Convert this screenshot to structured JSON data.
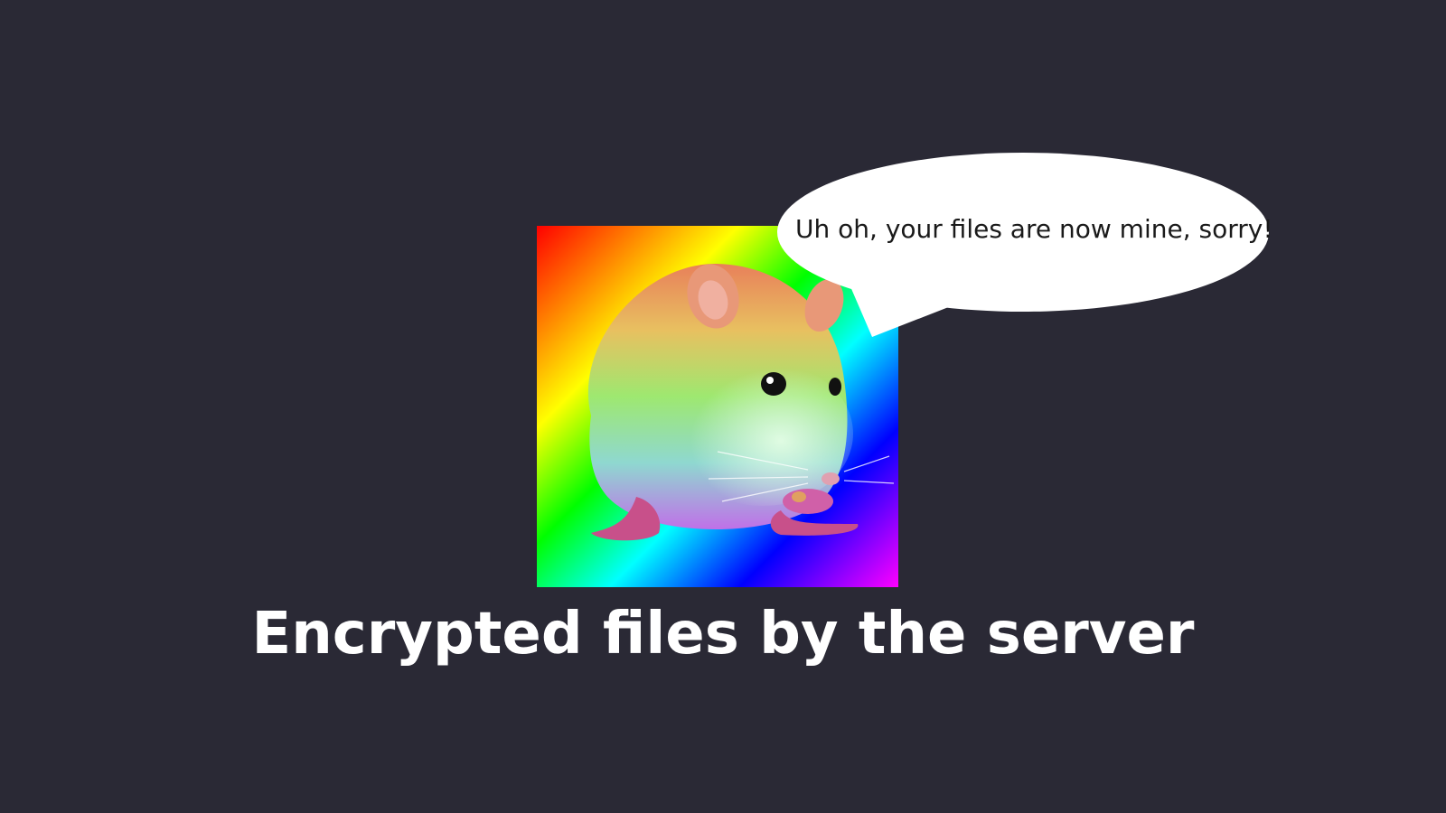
{
  "speech_bubble": {
    "text": "Uh oh, your files are now mine, sorry!"
  },
  "caption": {
    "text": "Encrypted files by the server"
  },
  "colors": {
    "background": "#2a2935",
    "caption_text": "#ffffff",
    "bubble_fill": "#ffffff",
    "bubble_text": "#1a1a1a"
  },
  "icons": {
    "mascot": "rainbow-hamster-icon"
  }
}
